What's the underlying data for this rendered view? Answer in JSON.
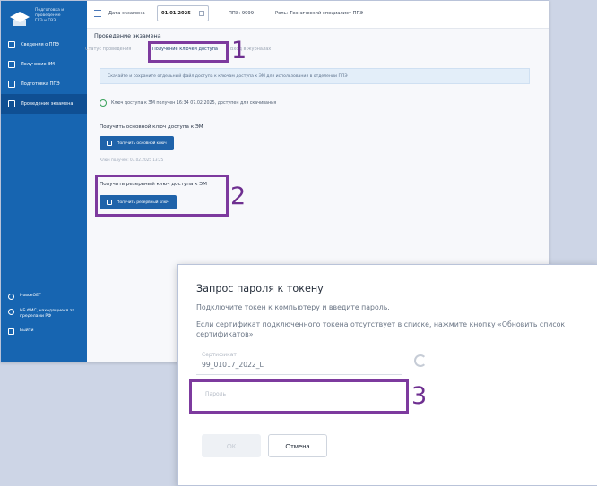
{
  "sidebar": {
    "logo_text": "Подготовка и\nпроведение\nГГЭ и ГВЭ",
    "items": [
      {
        "label": "Сведения о ППЭ"
      },
      {
        "label": "Получение ЭМ"
      },
      {
        "label": "Подготовка ППЭ"
      },
      {
        "label": "Проведение экзамена"
      }
    ],
    "user": "НовокОЕГ",
    "info": "ИБ ФИС, находящиеся за пределами РФ",
    "logout": "Выйти"
  },
  "topbar": {
    "date_label": "Дата экзамена",
    "date_value": "01.01.2025",
    "ppe": "ППЭ: 9999",
    "role": "Роль: Технический специалист ППЭ"
  },
  "content": {
    "title": "Проведение экзамена",
    "tabs": [
      "Статус проведения",
      "Получение ключей доступа",
      "Вход в журналах"
    ],
    "info_text": "Скачайте и сохраните отдельный файл доступа к ключам доступа к ЭМ для использования в отделении ППЭ",
    "status_text": "Ключ доступа к ЭМ получен 16:34 07.02.2025, доступен для скачивания",
    "main_key_label": "Получить основной ключ доступа к ЭМ",
    "main_key_button": "Получить основной ключ",
    "main_key_note": "Ключ получен: 07.02.2025 13:25",
    "reserve_key_label": "Получить резервный ключ доступа к ЭМ",
    "reserve_key_button": "Получить резервный ключ"
  },
  "annotations": {
    "n1": "1",
    "n2": "2",
    "n3": "3"
  },
  "dialog": {
    "title": "Запрос пароля к токену",
    "line1": "Подключите токен к компьютеру и введите пароль.",
    "line2": "Если сертификат подключенного токена отсутствует в списке, нажмите кнопку «Обновить список сертификатов»",
    "cert_label": "Сертификат",
    "cert_value": "99_01017_2022_L",
    "password_label": "Пароль",
    "ok_label": "ОК",
    "cancel_label": "Отмена"
  },
  "colors": {
    "sidebar": "#1765b1",
    "primary_button": "#1f63aa",
    "annotation": "#7d3a9e"
  }
}
